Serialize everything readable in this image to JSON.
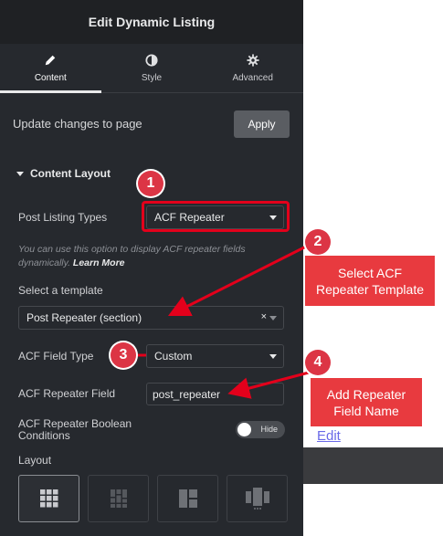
{
  "header": {
    "title": "Edit Dynamic Listing"
  },
  "tabs": [
    {
      "label": "Content",
      "icon": "pencil-icon"
    },
    {
      "label": "Style",
      "icon": "contrast-icon"
    },
    {
      "label": "Advanced",
      "icon": "gear-icon"
    }
  ],
  "update": {
    "text": "Update changes to page",
    "apply_label": "Apply"
  },
  "section": {
    "title": "Content Layout"
  },
  "fields": {
    "post_listing_types": {
      "label": "Post Listing Types",
      "value": "ACF Repeater"
    },
    "hint": {
      "text": "You can use this option to display ACF repeater fields dynamically. ",
      "link": "Learn More"
    },
    "template": {
      "label": "Select a template",
      "value": "Post Repeater (section)",
      "clear": "×"
    },
    "acf_field_type": {
      "label": "ACF Field Type",
      "value": "Custom"
    },
    "acf_repeater_field": {
      "label": "ACF Repeater Field",
      "value": "post_repeater"
    },
    "acf_boolean": {
      "label_line1": "ACF Repeater Boolean",
      "label_line2": "Conditions",
      "toggle_text": "Hide"
    },
    "layout": {
      "label": "Layout",
      "options": [
        "grid-icon",
        "masonry-icon",
        "metro-icon",
        "carousel-icon"
      ]
    }
  },
  "annotations": {
    "badges": [
      "1",
      "2",
      "3",
      "4"
    ],
    "callout_2": {
      "line1": "Select ACF",
      "line2": "Repeater Template"
    },
    "callout_4": {
      "line1": "Add Repeater",
      "line2": "Field Name"
    },
    "accent": "#e3001b"
  },
  "preview": {
    "edit_link": "Edit"
  }
}
